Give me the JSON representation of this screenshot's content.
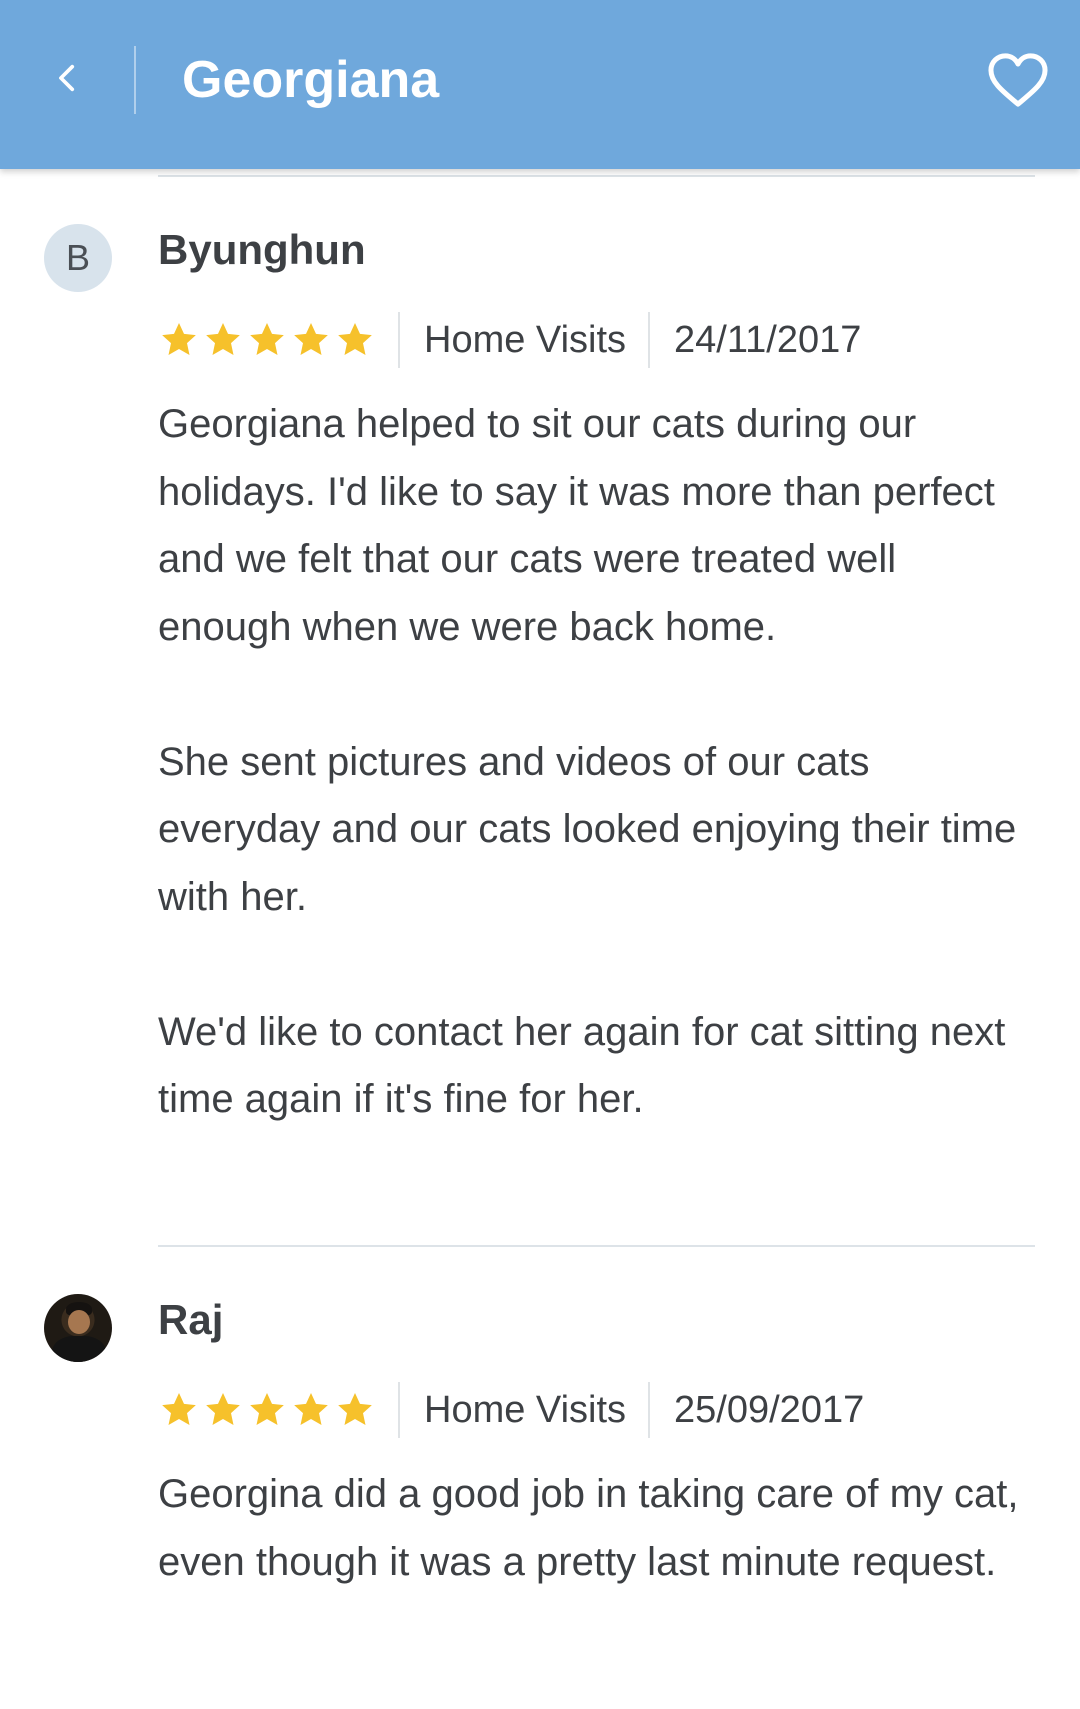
{
  "header": {
    "title": "Georgiana",
    "back_icon": "chevron-left-icon",
    "favorite_icon": "heart-outline-icon",
    "background_color": "#6fa8dc"
  },
  "star_color": "#f6c12b",
  "reviews": [
    {
      "avatar_initial": "B",
      "name": "Byunghun",
      "rating": 5,
      "service": "Home Visits",
      "date": "24/11/2017",
      "paragraphs": [
        "Georgiana helped to sit our cats during our holidays. I'd like to say it was more than perfect and we felt that our cats were treated well enough when we were back home.",
        "She sent pictures and videos of our cats everyday and our cats looked enjoying their time with her.",
        "We'd like to contact her again for cat sitting next time again if it's fine for her."
      ]
    },
    {
      "avatar_initial": "",
      "name": "Raj",
      "rating": 5,
      "service": "Home Visits",
      "date": "25/09/2017",
      "paragraphs": [
        "Georgina did a good job in taking care of my cat, even though it was a pretty last minute request."
      ]
    }
  ]
}
